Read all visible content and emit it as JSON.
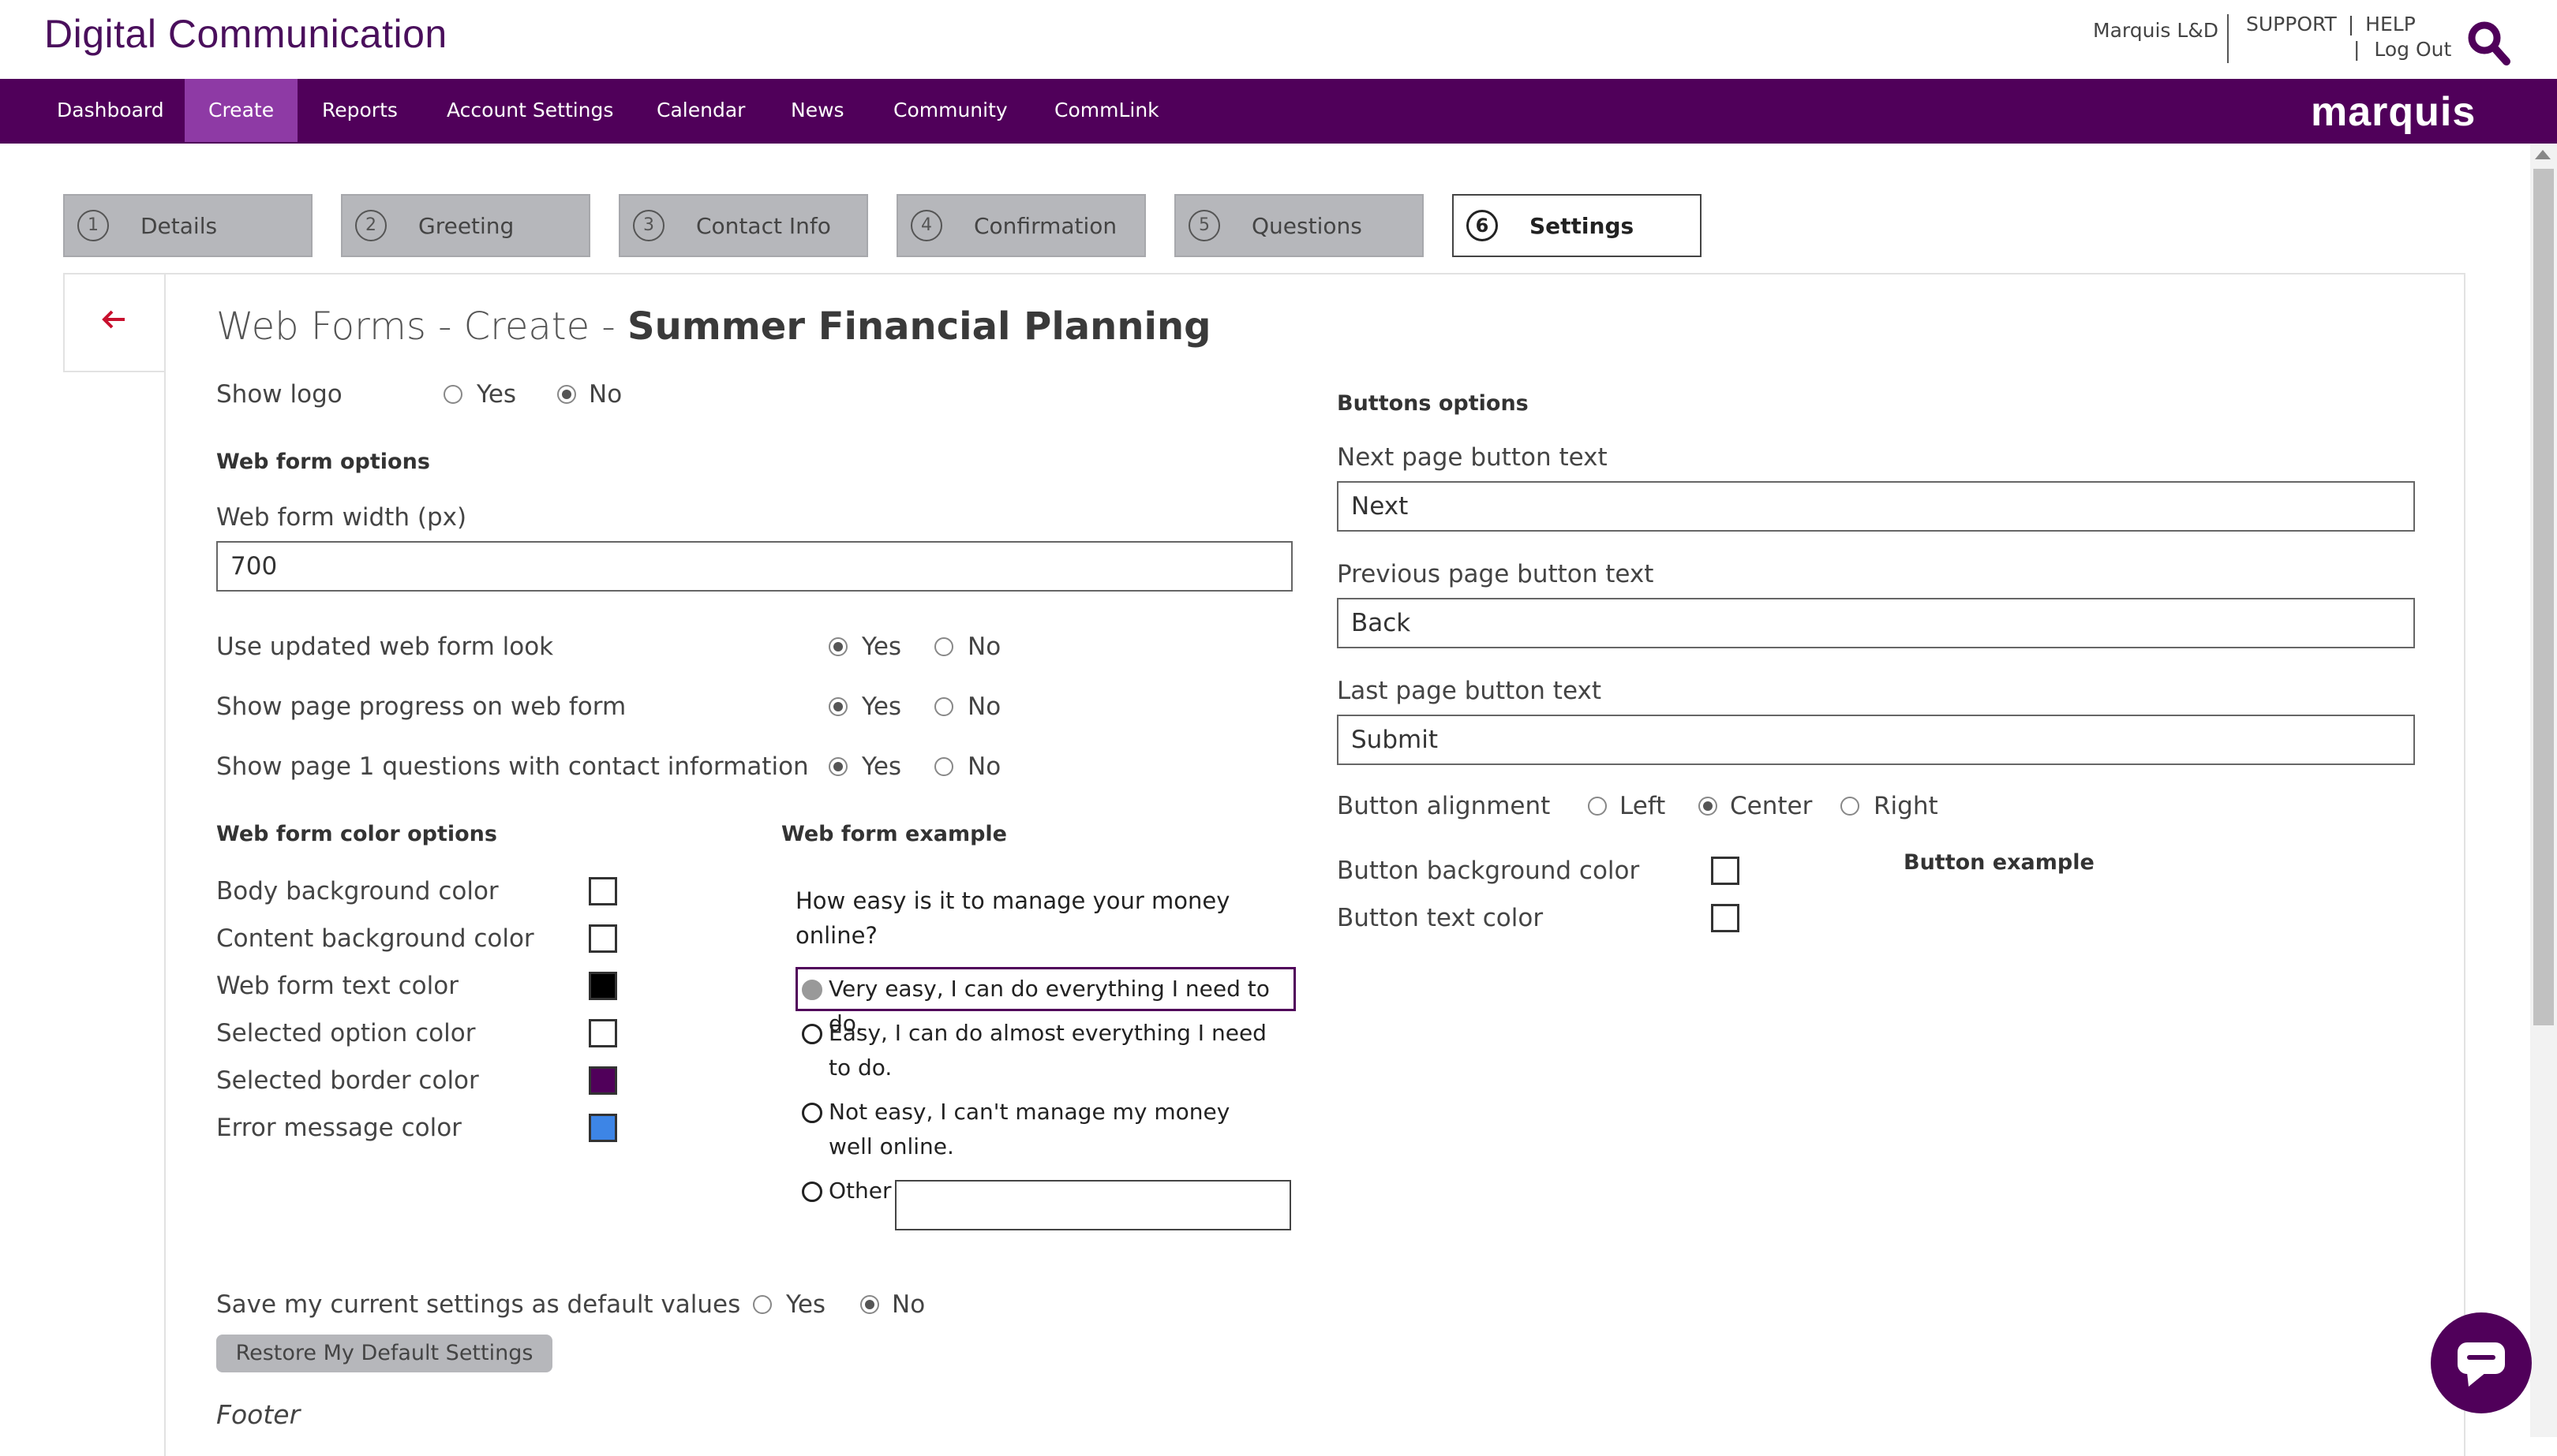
{
  "header": {
    "brand": "Digital Communication",
    "account": "Marquis L&D",
    "support": "SUPPORT",
    "help_sep": "|",
    "help": "HELP",
    "logout_sep": "|",
    "logout": "Log Out",
    "logo": "marquis"
  },
  "nav": {
    "items": [
      "Dashboard",
      "Create",
      "Reports",
      "Account Settings",
      "Calendar",
      "News",
      "Community",
      "CommLink"
    ],
    "active": "Create"
  },
  "steps": [
    {
      "num": "1",
      "label": "Details"
    },
    {
      "num": "2",
      "label": "Greeting"
    },
    {
      "num": "3",
      "label": "Contact Info"
    },
    {
      "num": "4",
      "label": "Confirmation"
    },
    {
      "num": "5",
      "label": "Questions"
    },
    {
      "num": "6",
      "label": "Settings",
      "active": true
    }
  ],
  "page": {
    "title_prefix": "Web Forms - Create - ",
    "title_name": "Summer Financial Planning"
  },
  "options": {
    "yes": "Yes",
    "no": "No",
    "show_logo": "Show logo",
    "web_form_options": "Web form options",
    "width_label": "Web form width (px)",
    "width_value": "700",
    "updated_look": "Use updated web form look",
    "page_progress": "Show page progress on web form",
    "page1_contact": "Show page 1 questions with contact information",
    "color_options": "Web form color options",
    "example_heading": "Web form example",
    "save_defaults": "Save my current settings as default values",
    "restore": "Restore My Default Settings",
    "footer": "Footer"
  },
  "colors": {
    "body_bg": {
      "label": "Body background color",
      "value": "#ffffff"
    },
    "content_bg": {
      "label": "Content background color",
      "value": "#ffffff"
    },
    "text": {
      "label": "Web form text color",
      "value": "#000000"
    },
    "selected_option": {
      "label": "Selected option color",
      "value": "#ffffff"
    },
    "selected_border": {
      "label": "Selected border color",
      "value": "#50005a"
    },
    "error": {
      "label": "Error message color",
      "value": "#3d85e6"
    }
  },
  "example": {
    "question": "How easy is it to manage your money online?",
    "opt1": "Very easy, I can do everything I need to do.",
    "opt2": "Easy, I can do almost everything I need to do.",
    "opt3": "Not easy, I can't manage my money well online.",
    "opt4": "Other"
  },
  "buttons": {
    "heading": "Buttons options",
    "next_label": "Next page button text",
    "next_value": "Next",
    "prev_label": "Previous page button text",
    "prev_value": "Back",
    "last_label": "Last page button text",
    "last_value": "Submit",
    "alignment_label": "Button alignment",
    "left": "Left",
    "center": "Center",
    "right": "Right",
    "bg_color_label": "Button background color",
    "text_color_label": "Button text color",
    "example_heading": "Button example"
  }
}
